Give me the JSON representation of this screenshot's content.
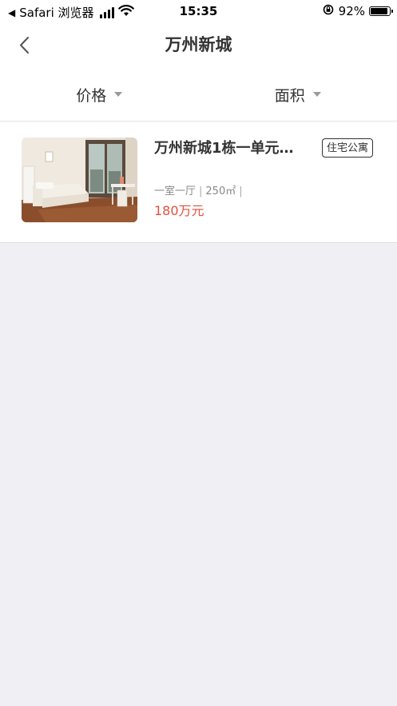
{
  "status_bar": {
    "back_app": "Safari 浏览器",
    "time": "15:35",
    "battery": "92%",
    "battery_level": 0.92
  },
  "nav": {
    "title": "万州新城"
  },
  "filters": [
    {
      "label": "价格"
    },
    {
      "label": "面积"
    }
  ],
  "listing": {
    "title": "万州新城1栋一单元…",
    "tag": "住宅公寓",
    "layout": "一室一厅",
    "area": "250㎡",
    "price": "180万元"
  },
  "colors": {
    "accent_price": "#e0503f",
    "page_background": "#f0eff4"
  }
}
